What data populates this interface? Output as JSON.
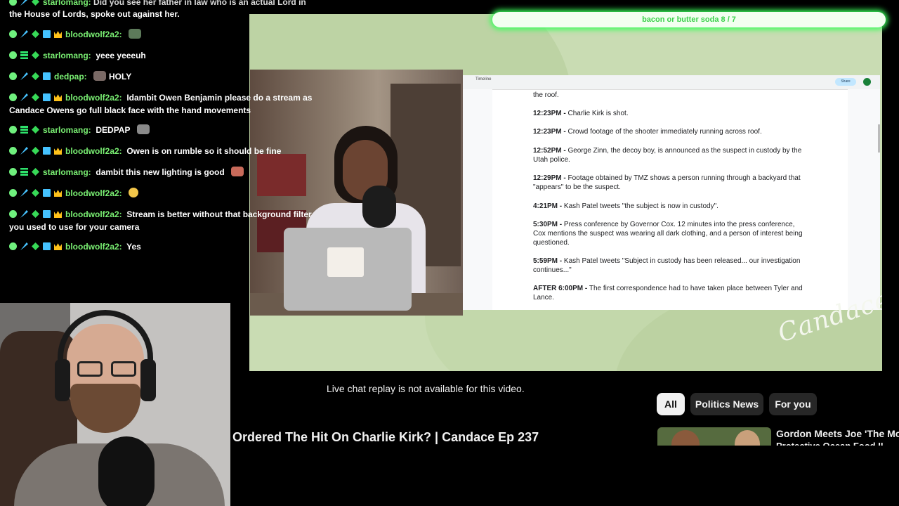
{
  "poll": {
    "text": "bacon or butter soda 8 / 7"
  },
  "chat": {
    "top_line1": "starlomang: Did you see her father in law who is an actual Lord in",
    "top_line2": "the House of Lords, spoke out against her.",
    "messages": [
      {
        "user": "bloodwolf2a2:",
        "text": "",
        "badges": "x,sw,gr,cr",
        "emote": "#5d7a5a"
      },
      {
        "user": "starlomang:",
        "text": "yeee yeeeuh",
        "badges": "x,eq,dia",
        "emote": ""
      },
      {
        "user": "dedpap:",
        "text": "HOLY",
        "badges": "x,sw,gr",
        "emote_before": "#7a6a66"
      },
      {
        "user": "bloodwolf2a2:",
        "text": "Idambit Owen Benjamin please do a stream as",
        "text2": "Candace Owens go full black face with the hand movements",
        "badges": "x,sw,gr,cr",
        "emote": ""
      },
      {
        "user": "starlomang:",
        "text": "DEDPAP",
        "badges": "x,eq,dia",
        "emote": "#8a8a8a"
      },
      {
        "user": "bloodwolf2a2:",
        "text": "Owen is on rumble so it should be fine",
        "badges": "x,sw,gr,cr",
        "emote": ""
      },
      {
        "user": "starlomang:",
        "text": "dambit this new lighting is good",
        "badges": "x,eq,dia",
        "emote": "#c86a5a"
      },
      {
        "user": "bloodwolf2a2:",
        "text": "",
        "badges": "x,sw,gr,cr",
        "emote": "#f3c64a"
      },
      {
        "user": "bloodwolf2a2:",
        "text": "Stream is better without that background filter",
        "text2": "you used to use for your camera",
        "badges": "x,sw,gr,cr",
        "emote": ""
      },
      {
        "user": "bloodwolf2a2:",
        "text": "Yes",
        "badges": "x,sw,gr,cr",
        "emote": ""
      }
    ]
  },
  "doc": {
    "app_title": "Timeline",
    "share_label": "Share",
    "top_fragment": "the roof.",
    "entries": [
      {
        "time": "12:23PM -",
        "text": "Charlie Kirk is shot."
      },
      {
        "time": "12:23PM -",
        "text": "Crowd footage of the shooter immediately running across roof."
      },
      {
        "time": "12:52PM -",
        "text": "George Zinn, the decoy boy, is announced as the suspect in custody by the",
        "text2": "Utah police."
      },
      {
        "time": "12:29PM -",
        "text": "Footage obtained by TMZ shows a person running through a backyard that",
        "text2": "\"appears\" to be the suspect."
      },
      {
        "time": "4:21PM -",
        "text": "Kash Patel tweets \"the subject is now in custody\"."
      },
      {
        "time": "5:30PM -",
        "text": "Press conference by Governor Cox. 12 minutes into the press conference,",
        "text2": "Cox mentions the suspect was wearing all dark clothing, and a person of interest being",
        "text3": "questioned."
      },
      {
        "time": "5:59PM -",
        "text": "Kash Patel tweets \"Subject in custody has been released... our investigation",
        "text2": "continues...\""
      },
      {
        "time": "AFTER 6:00PM -",
        "text": "The first correspondence had to have taken place between Tyler and",
        "text2": "Lance."
      }
    ]
  },
  "watermark": "Candace",
  "youtube": {
    "replay_notice": "Live chat replay is not available for this video.",
    "video_title": "Ordered The Hit On Charlie Kirk? | Candace Ep 237",
    "chips": [
      "All",
      "Politics News",
      "For you"
    ],
    "related_title": "Gordon Meets Joe 'The Mos",
    "related_sub": "Protective Ocean Food II"
  }
}
